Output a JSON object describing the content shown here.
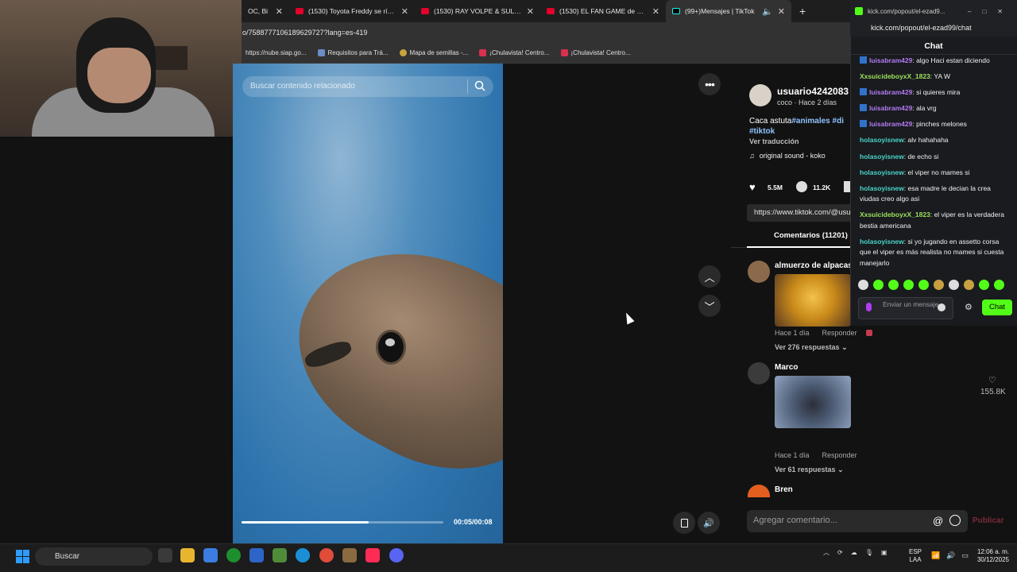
{
  "browser": {
    "tabs": [
      {
        "title": "OC, Bi",
        "type": "yt"
      },
      {
        "title": "(1530) Toyota Freddy se ríe mu",
        "type": "yt"
      },
      {
        "title": "(1530) RAY VOLPE & SULLIVAN",
        "type": "yt"
      },
      {
        "title": "(1530) EL FAN GAME de FNAF",
        "type": "yt"
      },
      {
        "title": "(99+)Mensajes | TikTok",
        "type": "tiktok",
        "active": true
      }
    ],
    "url": "o/7588777106189629727?lang=es-419",
    "bookmarks": [
      "https://nube.siap.go...",
      "Requisitos para Trá...",
      "Mapa de semillas -...",
      "¡Chulavista! Centro...",
      "¡Chulavista! Centro..."
    ]
  },
  "video": {
    "search_placeholder": "Buscar contenido relacionado",
    "time": "00:05/00:08",
    "progress": 0.63
  },
  "post": {
    "author": "usuario4242083",
    "subtitle": "coco · Hace 2 días",
    "caption_text": "Caca astuta",
    "caption_tags": "#animales #di #tiktok",
    "translate": "Ver traducción",
    "sound": "original sound - koko",
    "likes": "5.5M",
    "comments_count": "11.2K",
    "link": "https://www.tiktok.com/@usu",
    "comments_tab": "Comentarios (11201)"
  },
  "comments": [
    {
      "name": "almuerzo de alpacas",
      "time": "Hace 1 día",
      "reply": "Responder",
      "replies": "Ver 276 respuestas"
    },
    {
      "name": "Marco",
      "time": "Hace 1 día",
      "reply": "Responder",
      "replies": "Ver 61 respuestas",
      "likes": "155.8K"
    },
    {
      "name": "Bren"
    }
  ],
  "comment_box": {
    "placeholder": "Agregar comentario...",
    "at": "@",
    "publish": "Publicar"
  },
  "kick": {
    "window_url": "kick.com/popout/el-ezad9...",
    "url": "kick.com/popout/el-ezad99/chat",
    "title": "Chat",
    "messages": [
      {
        "user": "luisabram429",
        "color": "#b37bf2",
        "badge": true,
        "text": "algo Haci estan diciendo"
      },
      {
        "user": "XxsuicideboyxX_1823",
        "color": "#9de05a",
        "badge": false,
        "text": "YA W"
      },
      {
        "user": "luisabram429",
        "color": "#b37bf2",
        "badge": true,
        "text": "si quieres mira"
      },
      {
        "user": "luisabram429",
        "color": "#b37bf2",
        "badge": true,
        "text": "ala vrg"
      },
      {
        "user": "luisabram429",
        "color": "#b37bf2",
        "badge": true,
        "text": "pinches melones"
      },
      {
        "user": "holasoyisnew",
        "color": "#4ad4c8",
        "badge": false,
        "text": "alv hahahaha"
      },
      {
        "user": "holasoyisnew",
        "color": "#4ad4c8",
        "badge": false,
        "text": "de echo si"
      },
      {
        "user": "holasoyisnew",
        "color": "#4ad4c8",
        "badge": false,
        "text": "el viper no mames si"
      },
      {
        "user": "holasoyisnew",
        "color": "#4ad4c8",
        "badge": false,
        "text": "esa madre le decian la crea viudas creo algo asi"
      },
      {
        "user": "XxsuicideboyxX_1823",
        "color": "#9de05a",
        "badge": false,
        "text": "el viper es la verdadera bestia americana"
      },
      {
        "user": "holasoyisnew",
        "color": "#4ad4c8",
        "badge": false,
        "text": "si yo jugando en assetto corsa que el viper es más realista no mames si cuesta manejarlo"
      }
    ],
    "input_placeholder": "Enviar un mensaje",
    "send": "Chat"
  },
  "taskbar": {
    "search": "Buscar",
    "lang": "ESP",
    "lang2": "LAA",
    "time": "12:06 a. m.",
    "date": "30/12/2025"
  },
  "colors": {
    "kick_green": "#53fc18",
    "tag_blue": "#8fc3ff",
    "accent_red": "#fe2c55"
  }
}
